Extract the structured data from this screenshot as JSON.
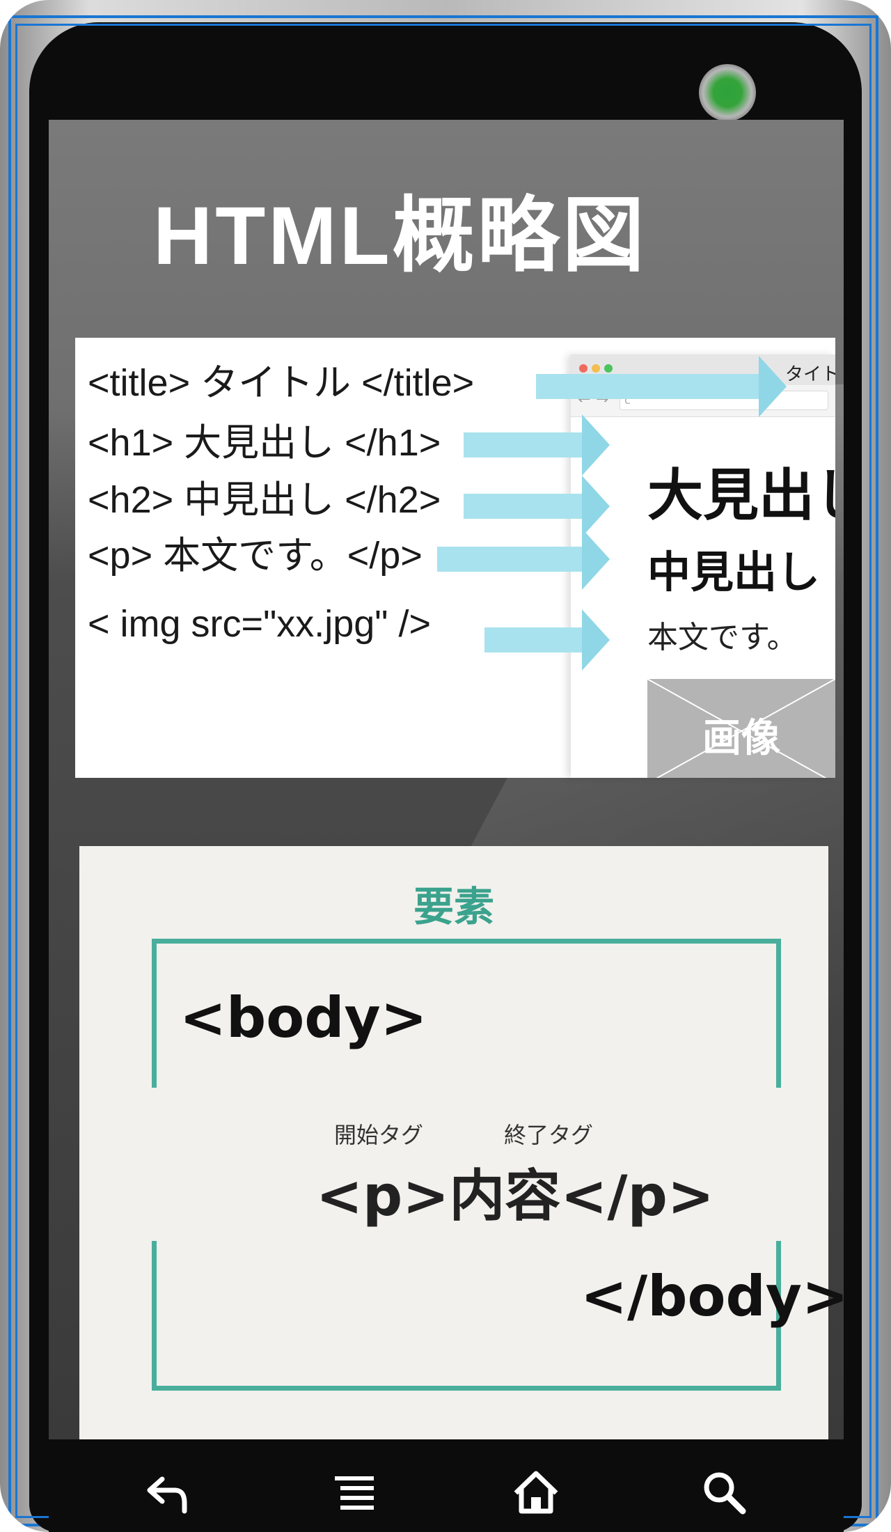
{
  "screen": {
    "title": "HTML概略図"
  },
  "html_panel": {
    "code_lines": [
      "<title> タイトル </title>",
      "<h1> 大見出し </h1>",
      "<h2> 中見出し </h2>",
      "<p> 本文です。</p>",
      "< img src=\"xx.jpg\" />"
    ],
    "browser": {
      "tab_title": "タイトル",
      "url_text": "c",
      "heading1": "大見出し",
      "heading2": "中見出し",
      "paragraph": "本文です。",
      "image_label": "画像"
    },
    "arrow_color": "#a8e2ee"
  },
  "element_panel": {
    "heading": "要素",
    "body_open": "<body>",
    "start_tag_label": "開始タグ",
    "end_tag_label": "終了タグ",
    "p_element": "<p>内容</p>",
    "body_close": "</body>",
    "accent_color": "#4aae9c"
  },
  "navbar": {
    "icons": [
      "back-icon",
      "menu-icon",
      "home-icon",
      "search-icon"
    ]
  }
}
